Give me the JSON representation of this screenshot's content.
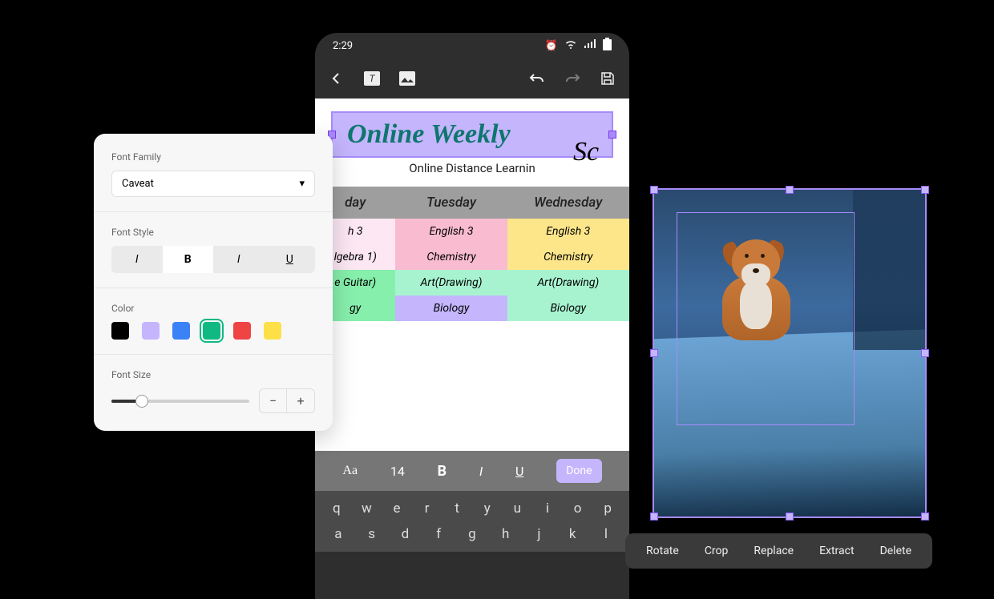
{
  "phone": {
    "status": {
      "time": "2:29"
    },
    "title_text": "Online Weekly",
    "title_extra": "Sc",
    "subtitle": "Online Distance Learnin",
    "text_toolbar": {
      "font_label": "Aa",
      "size": "14",
      "bold": "B",
      "italic": "I",
      "underline": "U",
      "done": "Done"
    },
    "keyboard": {
      "row1": [
        "q",
        "w",
        "e",
        "r",
        "t",
        "y",
        "u",
        "i",
        "o",
        "p"
      ],
      "row2": [
        "a",
        "s",
        "d",
        "f",
        "g",
        "h",
        "j",
        "k",
        "l"
      ]
    },
    "schedule": {
      "headers": [
        "day",
        "Tuesday",
        "Wednesday"
      ],
      "rows": [
        {
          "c0": "h 3",
          "c1": "English 3",
          "c2": "English 3",
          "cls": [
            "c-ltpink",
            "c-pink",
            "c-yellow"
          ]
        },
        {
          "c0": "lgebra 1)",
          "c1": "Chemistry",
          "c2": "Chemistry",
          "cls": [
            "c-ltpink",
            "c-pink",
            "c-yellow"
          ]
        },
        {
          "c0": "e Guitar)",
          "c1": "Art(Drawing)",
          "c2": "Art(Drawing)",
          "cls": [
            "c-green",
            "c-teal",
            "c-teal"
          ]
        },
        {
          "c0": "gy",
          "c1": "Biology",
          "c2": "Biology",
          "cls": [
            "c-green",
            "c-purple",
            "c-teal"
          ]
        }
      ]
    }
  },
  "font_panel": {
    "family_label": "Font Family",
    "family_value": "Caveat",
    "style_label": "Font Style",
    "style_italic": "I",
    "style_bold": "B",
    "style_italic2": "I",
    "style_underline": "U",
    "color_label": "Color",
    "colors": [
      "#000000",
      "#c4b5fd",
      "#3b82f6",
      "#10b981",
      "#ef4444",
      "#fde047"
    ],
    "selected_color_index": 3,
    "size_label": "Font Size",
    "stepper_minus": "−",
    "stepper_plus": "+"
  },
  "image_toolbar": {
    "rotate": "Rotate",
    "crop": "Crop",
    "replace": "Replace",
    "extract": "Extract",
    "delete": "Delete"
  }
}
